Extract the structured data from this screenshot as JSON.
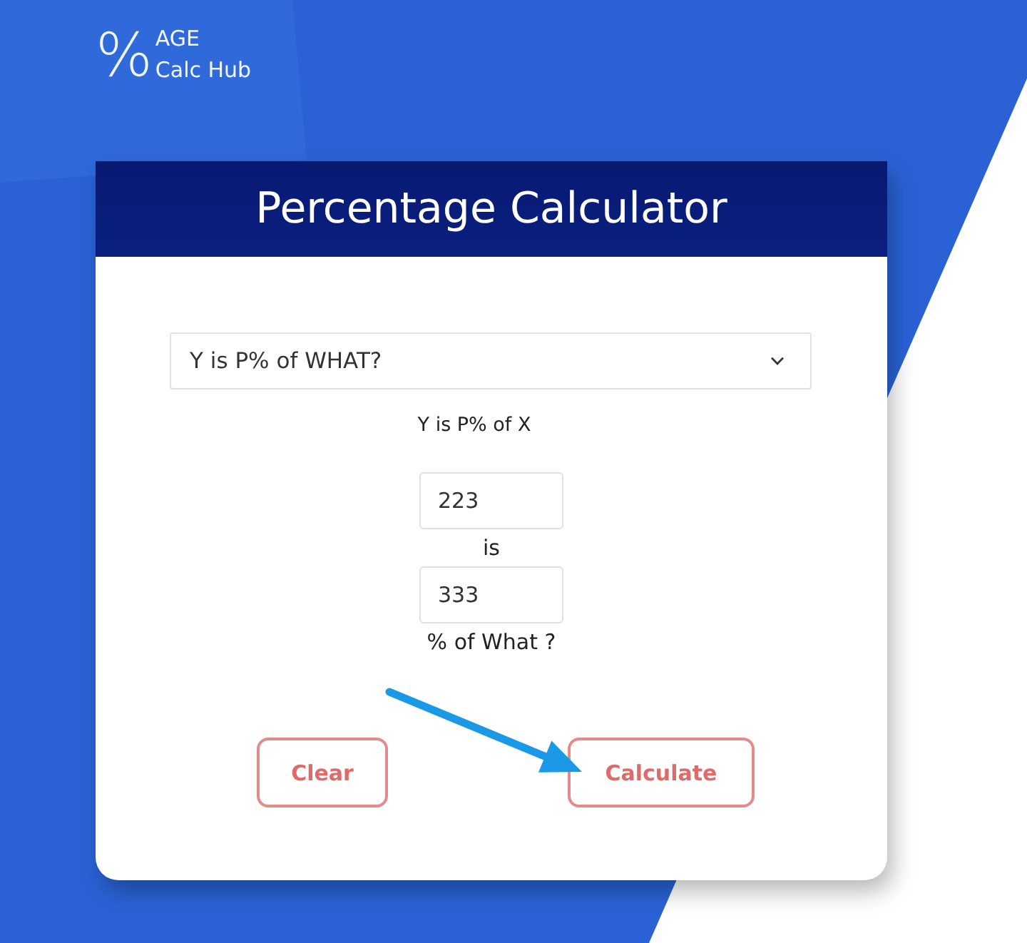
{
  "logo": {
    "symbol": "%",
    "line1": "AGE",
    "line2": "Calc Hub"
  },
  "card": {
    "title": "Percentage Calculator"
  },
  "mode_select": {
    "value": "Y is P% of WHAT?"
  },
  "formula": "Y is P% of X",
  "form": [
    {
      "kind": "input",
      "value": "223"
    },
    {
      "kind": "text",
      "text": "is"
    },
    {
      "kind": "input",
      "value": "333"
    },
    {
      "kind": "text",
      "text": "% of What ?"
    }
  ],
  "buttons": [
    {
      "label": "Clear"
    },
    {
      "label": "Calculate"
    }
  ]
}
